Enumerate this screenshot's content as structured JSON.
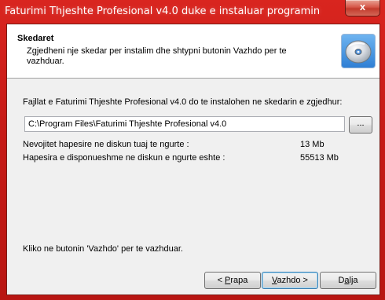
{
  "window": {
    "title": "Faturimi Thjeshte Profesional v4.0 duke e instaluar programin",
    "close_label": "x"
  },
  "header": {
    "title": "Skedaret",
    "description": "Zgjedheni nje skedar per instalim dhe shtypni butonin Vazhdo per te vazhduar.",
    "icon": "cd-disc-icon"
  },
  "main": {
    "info_text": "Fajllat e Faturimi Thjeshte Profesional v4.0 do te instalohen ne skedarin e zgjedhur:",
    "install_path": "C:\\Program Files\\Faturimi Thjeshte Profesional v4.0",
    "browse_label": "...",
    "required_space_label": "Nevojitet hapesire ne diskun tuaj te ngurte :",
    "required_space_value": "13 Mb",
    "available_space_label": "Hapesira e disponueshme ne diskun e ngurte eshte :",
    "available_space_value": "55513 Mb",
    "continue_hint": "Kliko ne butonin 'Vazhdo' per te vazhduar."
  },
  "buttons": {
    "back_prefix": "< ",
    "back_mnemonic": "P",
    "back_rest": "rapa",
    "next_mnemonic": "V",
    "next_rest": "azhdo >",
    "exit_prefix": "D",
    "exit_mnemonic": "a",
    "exit_rest": "lja"
  }
}
